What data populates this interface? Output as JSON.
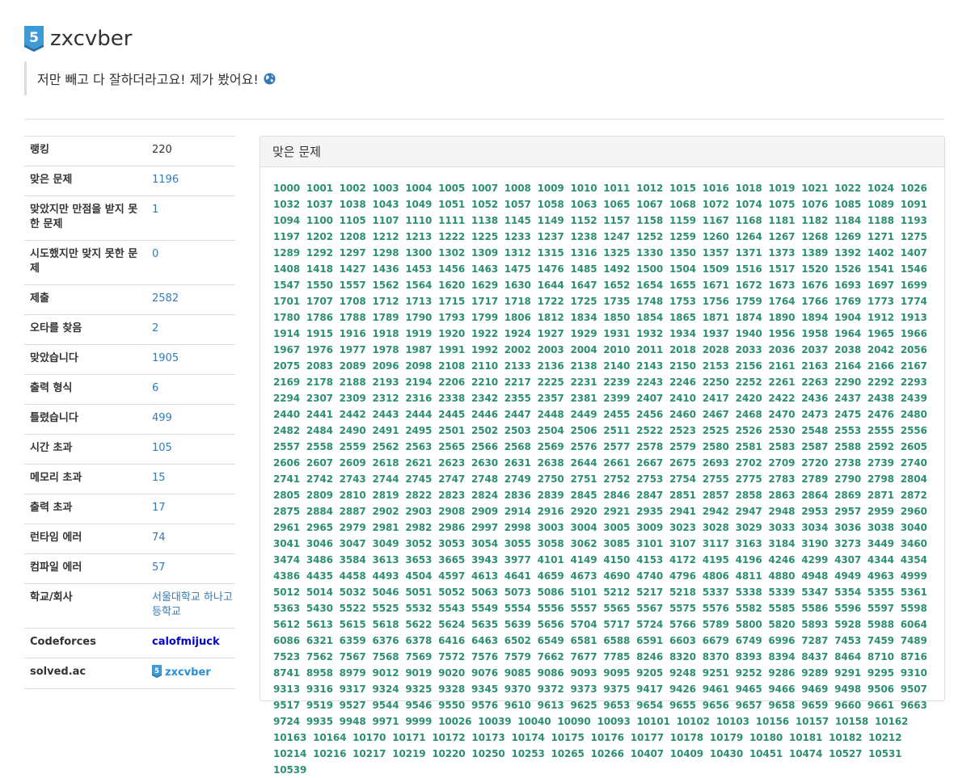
{
  "profile": {
    "username": "zxcvber",
    "bio": "저만 빼고 다 잘하더라고요! 제가 봤어요!",
    "tier_glyph": "5",
    "tier_color": "#3d9ad6"
  },
  "stats": [
    {
      "key": "랭킹",
      "value": "220",
      "style": "plain"
    },
    {
      "key": "맞은 문제",
      "value": "1196",
      "style": "link"
    },
    {
      "key": "맞았지만 만점을 받지 못한 문제",
      "value": "1",
      "style": "link"
    },
    {
      "key": "시도했지만 맞지 못한 문제",
      "value": "0",
      "style": "link"
    },
    {
      "key": "제출",
      "value": "2582",
      "style": "link"
    },
    {
      "key": "오타를 찾음",
      "value": "2",
      "style": "link"
    },
    {
      "key": "맞았습니다",
      "value": "1905",
      "style": "link"
    },
    {
      "key": "출력 형식",
      "value": "6",
      "style": "link"
    },
    {
      "key": "틀렸습니다",
      "value": "499",
      "style": "link"
    },
    {
      "key": "시간 초과",
      "value": "105",
      "style": "link"
    },
    {
      "key": "메모리 초과",
      "value": "15",
      "style": "link"
    },
    {
      "key": "출력 초과",
      "value": "17",
      "style": "link"
    },
    {
      "key": "런타임 에러",
      "value": "74",
      "style": "link"
    },
    {
      "key": "컴파일 에러",
      "value": "57",
      "style": "link"
    },
    {
      "key": "학교/회사",
      "value": "서울대학교 하나고등학교",
      "style": "link"
    },
    {
      "key": "Codeforces",
      "value": "calofmijuck",
      "style": "cf"
    },
    {
      "key": "solved.ac",
      "value": "zxcvber",
      "style": "sac"
    }
  ],
  "solved_panel": {
    "title": "맞은 문제",
    "problems": "1000 1001 1002 1003 1004 1005 1007 1008 1009 1010 1011 1012 1015 1016 1018 1019 1021 1022 1024 1026 1032 1037 1038 1043 1049 1051 1052 1057 1058 1063 1065 1067 1068 1072 1074 1075 1076 1085 1089 1091 1094 1100 1105 1107 1110 1111 1138 1145 1149 1152 1157 1158 1159 1167 1168 1181 1182 1184 1188 1193 1197 1202 1208 1212 1213 1222 1225 1233 1237 1238 1247 1252 1259 1260 1264 1267 1268 1269 1271 1275 1289 1292 1297 1298 1300 1302 1309 1312 1315 1316 1325 1330 1350 1357 1371 1373 1389 1392 1402 1407 1408 1418 1427 1436 1453 1456 1463 1475 1476 1485 1492 1500 1504 1509 1516 1517 1520 1526 1541 1546 1547 1550 1557 1562 1564 1620 1629 1630 1644 1647 1652 1654 1655 1671 1672 1673 1676 1693 1697 1699 1701 1707 1708 1712 1713 1715 1717 1718 1722 1725 1735 1748 1753 1756 1759 1764 1766 1769 1773 1774 1780 1786 1788 1789 1790 1793 1799 1806 1812 1834 1850 1854 1865 1871 1874 1890 1894 1904 1912 1913 1914 1915 1916 1918 1919 1920 1922 1924 1927 1929 1931 1932 1934 1937 1940 1956 1958 1964 1965 1966 1967 1976 1977 1978 1987 1991 1992 2002 2003 2004 2010 2011 2018 2028 2033 2036 2037 2038 2042 2056 2075 2083 2089 2096 2098 2108 2110 2133 2136 2138 2140 2143 2150 2153 2156 2161 2163 2164 2166 2167 2169 2178 2188 2193 2194 2206 2210 2217 2225 2231 2239 2243 2246 2250 2252 2261 2263 2290 2292 2293 2294 2307 2309 2312 2316 2338 2342 2355 2357 2381 2399 2407 2410 2417 2420 2422 2436 2437 2438 2439 2440 2441 2442 2443 2444 2445 2446 2447 2448 2449 2455 2456 2460 2467 2468 2470 2473 2475 2476 2480 2482 2484 2490 2491 2495 2501 2502 2503 2504 2506 2511 2522 2523 2525 2526 2530 2548 2553 2555 2556 2557 2558 2559 2562 2563 2565 2566 2568 2569 2576 2577 2578 2579 2580 2581 2583 2587 2588 2592 2605 2606 2607 2609 2618 2621 2623 2630 2631 2638 2644 2661 2667 2675 2693 2702 2709 2720 2738 2739 2740 2741 2742 2743 2744 2745 2747 2748 2749 2750 2751 2752 2753 2754 2755 2775 2783 2789 2790 2798 2804 2805 2809 2810 2819 2822 2823 2824 2836 2839 2845 2846 2847 2851 2857 2858 2863 2864 2869 2871 2872 2875 2884 2887 2902 2903 2908 2909 2914 2916 2920 2921 2935 2941 2942 2947 2948 2953 2957 2959 2960 2961 2965 2979 2981 2982 2986 2997 2998 3003 3004 3005 3009 3023 3028 3029 3033 3034 3036 3038 3040 3041 3046 3047 3049 3052 3053 3054 3055 3058 3062 3085 3101 3107 3117 3163 3184 3190 3273 3449 3460 3474 3486 3584 3613 3653 3665 3943 3977 4101 4149 4150 4153 4172 4195 4196 4246 4299 4307 4344 4354 4386 4435 4458 4493 4504 4597 4613 4641 4659 4673 4690 4740 4796 4806 4811 4880 4948 4949 4963 4999 5012 5014 5032 5046 5051 5052 5063 5073 5086 5101 5212 5217 5218 5337 5338 5339 5347 5354 5355 5361 5363 5430 5522 5525 5532 5543 5549 5554 5556 5557 5565 5567 5575 5576 5582 5585 5586 5596 5597 5598 5612 5613 5615 5618 5622 5624 5635 5639 5656 5704 5717 5724 5766 5789 5800 5820 5893 5928 5988 6064 6086 6321 6359 6376 6378 6416 6463 6502 6549 6581 6588 6591 6603 6679 6749 6996 7287 7453 7459 7489 7523 7562 7567 7568 7569 7572 7576 7579 7662 7677 7785 8246 8320 8370 8393 8394 8437 8464 8710 8716 8741 8958 8979 9012 9019 9020 9076 9085 9086 9093 9095 9205 9248 9251 9252 9286 9289 9291 9295 9310 9313 9316 9317 9324 9325 9328 9345 9370 9372 9373 9375 9417 9426 9461 9465 9466 9469 9498 9506 9507 9517 9519 9527 9544 9546 9550 9576 9610 9613 9625 9653 9654 9655 9656 9657 9658 9659 9660 9661 9663 9724 9935 9948 9971 9999 10026 10039 10040 10090 10093 10101 10102 10103 10156 10157 10158 10162 10163 10164 10170 10171 10172 10173 10174 10175 10176 10177 10178 10179 10180 10181 10182 10212 10214 10216 10217 10219 10220 10250 10253 10265 10266 10407 10409 10430 10451 10474 10527 10531 10539"
  }
}
